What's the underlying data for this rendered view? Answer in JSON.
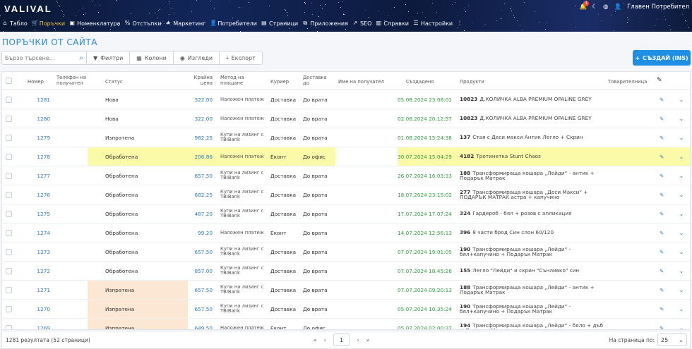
{
  "app": {
    "logo": "VALIVAL",
    "notifications_count": "1",
    "user_name": "Главен Потребител"
  },
  "nav": [
    {
      "label": "Табло",
      "icon": "home-icon",
      "glyph": "⌂",
      "active": false
    },
    {
      "label": "Поръчки",
      "icon": "cart-icon",
      "glyph": "🛒",
      "active": true
    },
    {
      "label": "Номенклатура",
      "icon": "box-icon",
      "glyph": "▣",
      "active": false
    },
    {
      "label": "Отстъпки",
      "icon": "percent-icon",
      "glyph": "%",
      "active": false
    },
    {
      "label": "Маркетинг",
      "icon": "star-icon",
      "glyph": "★",
      "active": false
    },
    {
      "label": "Потребители",
      "icon": "user-icon",
      "glyph": "👤",
      "active": false
    },
    {
      "label": "Страници",
      "icon": "page-icon",
      "glyph": "▤",
      "active": false
    },
    {
      "label": "Приложения",
      "icon": "apps-icon",
      "glyph": "⧉",
      "active": false
    },
    {
      "label": "SEO",
      "icon": "chart-icon",
      "glyph": "↗",
      "active": false
    },
    {
      "label": "Справки",
      "icon": "report-icon",
      "glyph": "▥",
      "active": false
    },
    {
      "label": "Настройки",
      "icon": "settings-icon",
      "glyph": "☰",
      "active": false
    },
    {
      "label": "",
      "icon": "more-icon",
      "glyph": "⋮",
      "active": false
    }
  ],
  "page_title": "ПОРЪЧКИ ОТ САЙТА",
  "toolbar": {
    "search_placeholder": "Бързо търсене...",
    "filters": "Филтри",
    "columns": "Колони",
    "views": "Изгледи",
    "export": "Експорт",
    "create": "СЪЗДАЙ (INS)"
  },
  "columns": {
    "number": "Номер",
    "phone": "Телефон на получател",
    "status": "Статус",
    "price": "Крайна цена",
    "payment": "Метод на плащане",
    "courier": "Куриер",
    "delivery": "Доставка до",
    "recipient": "Име на получател",
    "created": "Създадено",
    "products": "Продукти",
    "waybill": "Товарителница"
  },
  "rows": [
    {
      "id": "1281",
      "phone": "",
      "status": "Нова",
      "status_color": "",
      "price": "322.00",
      "payment": "Наложен платеж",
      "courier": "Доставка",
      "delivery": "До врата",
      "created": "05.08.2024 23:08:01",
      "pcode": "10823",
      "product": "Д.КОЛИЧКА ALBA PREMIUM OPALINE GREY",
      "highlight": false
    },
    {
      "id": "1280",
      "phone": "",
      "status": "Нова",
      "status_color": "",
      "price": "322.00",
      "payment": "Наложен платеж",
      "courier": "Доставка",
      "delivery": "До врата",
      "created": "02.08.2024 20:12:57",
      "pcode": "10823",
      "product": "Д.КОЛИЧКА ALBA PREMIUM OPALINE GREY",
      "highlight": false
    },
    {
      "id": "1279",
      "phone": "",
      "status": "Изпратена",
      "status_color": "",
      "price": "982.25",
      "payment": "Купи на лизинг с TBIBank",
      "courier": "Доставка",
      "delivery": "До врата",
      "created": "01.08.2024 15:24:38",
      "pcode": "137",
      "product": "Стая с Деси макси Антик Легло + Скрин",
      "highlight": false
    },
    {
      "id": "1278",
      "phone": "",
      "status": "Обработена",
      "status_color": "#fbfaa8",
      "price": "206.86",
      "payment": "Наложен платеж",
      "courier": "Еконт",
      "delivery": "До офис",
      "created": "30.07.2024 15:04:29",
      "pcode": "4182",
      "product": "Тротинетка Stunt Chaos",
      "highlight": true
    },
    {
      "id": "1277",
      "phone": "",
      "status": "Обработена",
      "status_color": "",
      "price": "657.50",
      "payment": "Купи на лизинг с TBIBank",
      "courier": "Доставка",
      "delivery": "До врата",
      "created": "26.07.2024 16:03:33",
      "pcode": "188",
      "product": "Трансформираща кошара „Лейди“ - антик + Подарък Матрак",
      "highlight": false
    },
    {
      "id": "1276",
      "phone": "",
      "status": "Обработена",
      "status_color": "",
      "price": "682.25",
      "payment": "Купи на лизинг с TBIBank",
      "courier": "Доставка",
      "delivery": "До врата",
      "created": "18.07.2024 23:15:02",
      "pcode": "277",
      "product": "Трансформираща кошара „Деси Макси“ + ПОДАРЪК МАТРАК астра + капучино",
      "highlight": false
    },
    {
      "id": "1275",
      "phone": "",
      "status": "Обработена",
      "status_color": "",
      "price": "487.20",
      "payment": "Купи на лизинг с TBIBank",
      "courier": "Доставка",
      "delivery": "До врата",
      "created": "17.07.2024 17:07:24",
      "pcode": "324",
      "product": "Гардероб - бял + розов с апликация",
      "highlight": false
    },
    {
      "id": "1274",
      "phone": "",
      "status": "Обработена",
      "status_color": "",
      "price": "99.20",
      "payment": "Наложен платеж",
      "courier": "Еконт",
      "delivery": "До врата",
      "created": "14.07.2024 12:56:13",
      "pcode": "396",
      "product": "8 части брод Син слон 60/120",
      "highlight": false
    },
    {
      "id": "1273",
      "phone": "",
      "status": "Обработена",
      "status_color": "",
      "price": "657.50",
      "payment": "Купи на лизинг с TBIBank",
      "courier": "Доставка",
      "delivery": "До врата",
      "created": "07.07.2024 19:01:05",
      "pcode": "190",
      "product": "Трансформираща кошара „Лейди“ - бял+капучино + Подарък Матрак",
      "highlight": false
    },
    {
      "id": "1272",
      "phone": "",
      "status": "Обработена",
      "status_color": "",
      "price": "857.00",
      "payment": "Купи на лизинг с TBIBank",
      "courier": "Доставка",
      "delivery": "До врата",
      "created": "07.07.2024 18:45:26",
      "pcode": "155",
      "product": "Легло \"Лейди\" и скрин \"Сънливко\" син",
      "highlight": false
    },
    {
      "id": "1271",
      "phone": "",
      "status": "Изпратена",
      "status_color": "#fbe7d3",
      "price": "657.50",
      "payment": "Купи на лизинг с TBIBank",
      "courier": "Доставка",
      "delivery": "До врата",
      "created": "07.07.2024 09:20:13",
      "pcode": "188",
      "product": "Трансформираща кошара „Лейди“ - антик + Подарък Матрак",
      "highlight": false
    },
    {
      "id": "1270",
      "phone": "",
      "status": "Изпратена",
      "status_color": "#fbe7d3",
      "price": "657.50",
      "payment": "Купи на лизинг с TBIBank",
      "courier": "Доставка",
      "delivery": "До врата",
      "created": "05.07.2024 10:35:24",
      "pcode": "190",
      "product": "Трансформираща кошара „Лейди“ - бял+капучино + Подарък Матрак",
      "highlight": false
    },
    {
      "id": "1269",
      "phone": "",
      "status": "Изпратена",
      "status_color": "#fbe7d3",
      "price": "649.50",
      "payment": "Наложен платеж",
      "courier": "Еконт",
      "delivery": "До офис",
      "created": "05.07.2024 02:00:37",
      "pcode": "194",
      "product": "Трансформираща кошара „Лейди“ - бяло + дъб + Подарък Матрак",
      "highlight": false
    }
  ],
  "footer": {
    "results": "1281 резултата (52 страници)",
    "current_page": "1",
    "per_page_label": "На страница по:",
    "per_page": "25"
  },
  "colors": {
    "accent": "#1f8fe3",
    "link": "#2a7bc0",
    "date": "#2e9e3c",
    "highlight_row": "#fbfaa8",
    "sent_status": "#fbe7d3"
  }
}
